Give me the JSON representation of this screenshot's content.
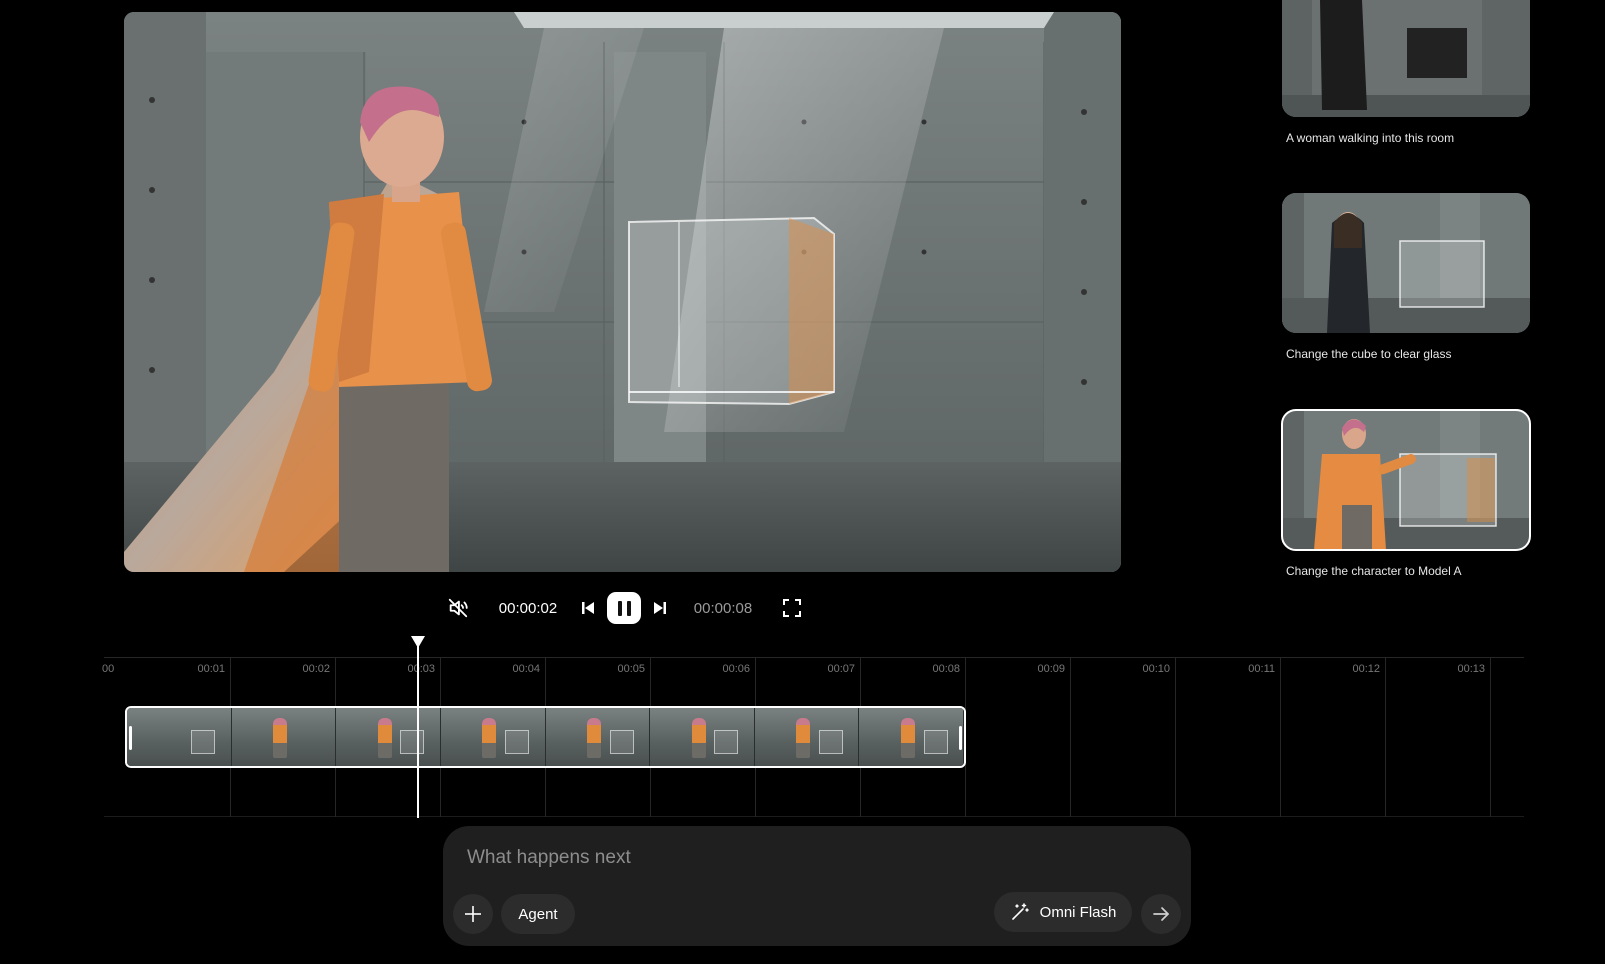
{
  "player": {
    "current_time": "00:00:02",
    "total_time": "00:00:08",
    "muted": true,
    "playing": true
  },
  "icons": {
    "mute": "volume-muted-icon",
    "previous": "skip-previous-icon",
    "pause": "pause-icon",
    "next": "skip-next-icon",
    "fullscreen": "fullscreen-icon",
    "add": "plus-icon",
    "magic": "magic-wand-icon",
    "send": "arrow-right-icon"
  },
  "suggestions": [
    {
      "caption": "A woman walking into this room",
      "selected": false
    },
    {
      "caption": "Change the cube to clear glass",
      "selected": false
    },
    {
      "caption": "Change the character to Model A",
      "selected": true
    }
  ],
  "timeline": {
    "ticks": [
      "00",
      "00:01",
      "00:02",
      "00:03",
      "00:04",
      "00:05",
      "00:06",
      "00:07",
      "00:08",
      "00:09",
      "00:10",
      "00:11",
      "00:12",
      "00:13"
    ],
    "clip_start_seconds": 0,
    "clip_end_seconds": 8,
    "playhead_seconds": 2.8
  },
  "prompt": {
    "placeholder": "What happens next",
    "agent_label": "Agent",
    "model_label": "Omni Flash"
  }
}
